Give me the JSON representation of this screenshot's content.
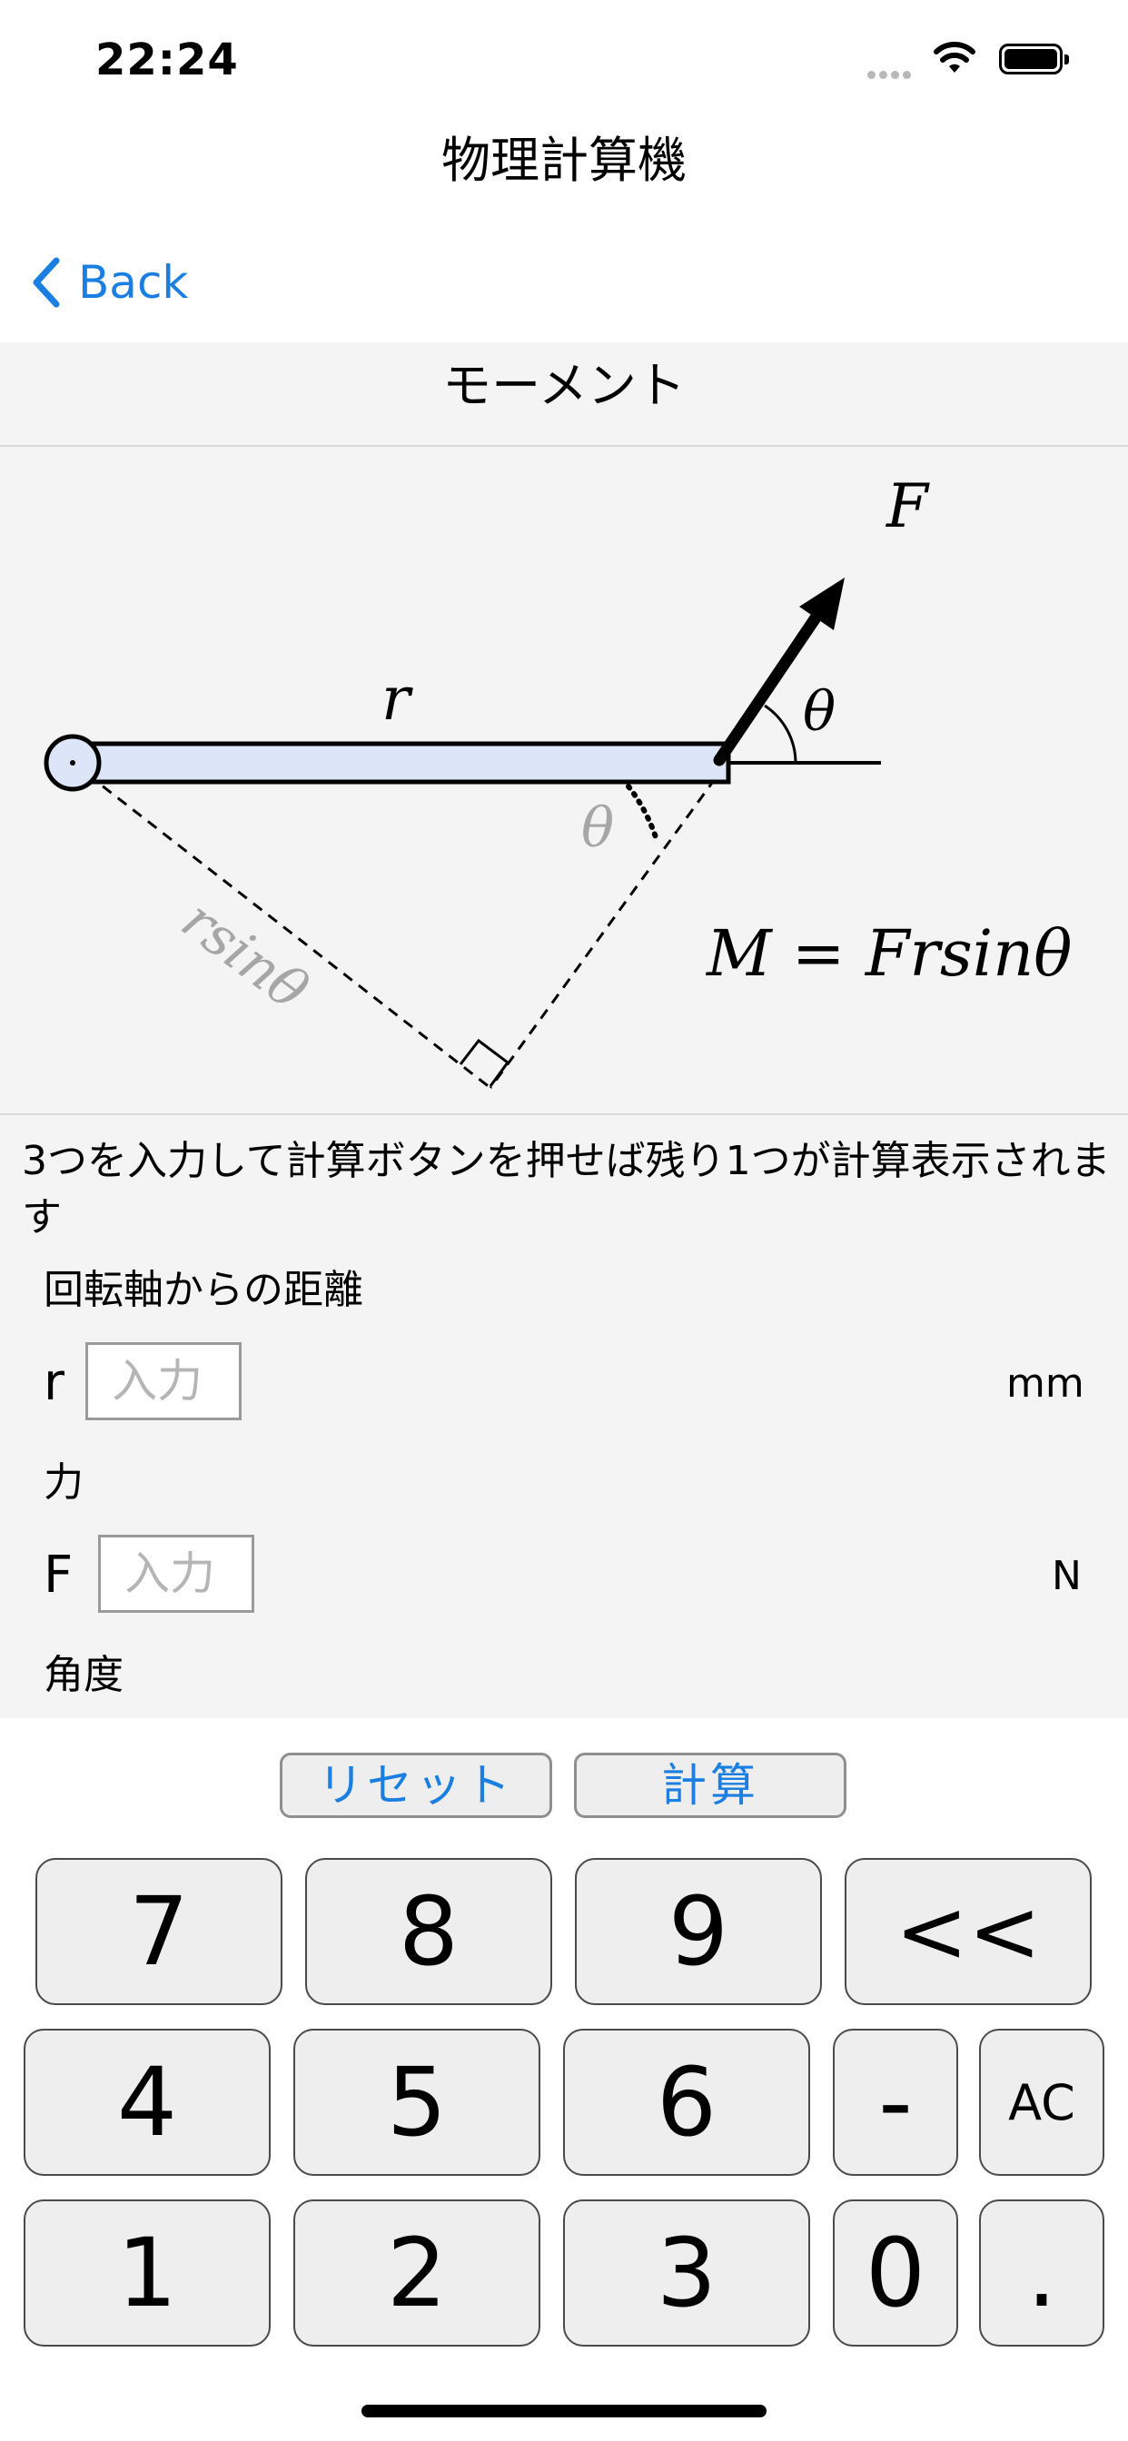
{
  "status_bar": {
    "time": "22:24"
  },
  "nav": {
    "title": "物理計算機",
    "back_label": "Back"
  },
  "section": {
    "title": "モーメント"
  },
  "diagram": {
    "labels": {
      "force": "F",
      "theta_top": "θ",
      "theta_inner": "θ",
      "radius": "r",
      "lever_arm": "rsinθ",
      "formula": "M = Frsinθ"
    }
  },
  "instruction": "3つを入力して計算ボタンを押せば残り1つが計算表示されます",
  "fields": [
    {
      "label": "回転軸からの距離",
      "symbol": "r",
      "placeholder": "入力",
      "unit": "mm"
    },
    {
      "label": "力",
      "symbol": "F",
      "placeholder": "入力",
      "unit": "N"
    },
    {
      "label": "角度"
    }
  ],
  "actions": {
    "reset": "リセット",
    "calculate": "計算"
  },
  "keypad": {
    "row1": [
      "7",
      "8",
      "9",
      "<<"
    ],
    "row2": [
      "4",
      "5",
      "6",
      "-",
      "AC"
    ],
    "row3": [
      "1",
      "2",
      "3",
      "0",
      "."
    ]
  }
}
